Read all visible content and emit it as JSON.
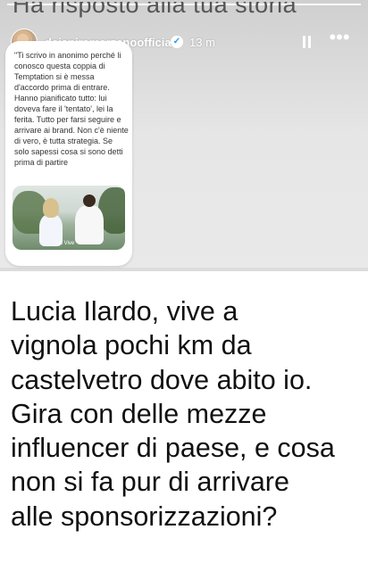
{
  "story": {
    "progress": 1.0,
    "reply_heading": "Ha risposto alla tua storia",
    "header": {
      "username": "deianiramarzanoofficial",
      "verified": true,
      "time": "13 m",
      "pause_icon": "pause-icon",
      "more_icon": "more-icon"
    },
    "message": {
      "text": "\"Ti scrivo in anonimo perché li conosco questa coppia di Temptation si è messa d'accordo prima di entrare. Hanno pianificato tutto: lui doveva fare il 'tentato', lei la ferita. Tutto per farsi seguire e arrivare ai brand. Non c'è niente di vero, è tutta strategia. Se solo sapessi cosa si sono detti prima di partire"
    },
    "photo": {
      "caption": "Lei Vive"
    },
    "response_lines": [
      "Lucia Ilardo,  vive  a",
      "vignola pochi km da",
      "castelvetro dove abito io.",
      "Gira con delle mezze",
      "influencer di paese, e cosa",
      "non si fa pur di arrivare",
      "alle sponsorizzazioni?"
    ]
  }
}
